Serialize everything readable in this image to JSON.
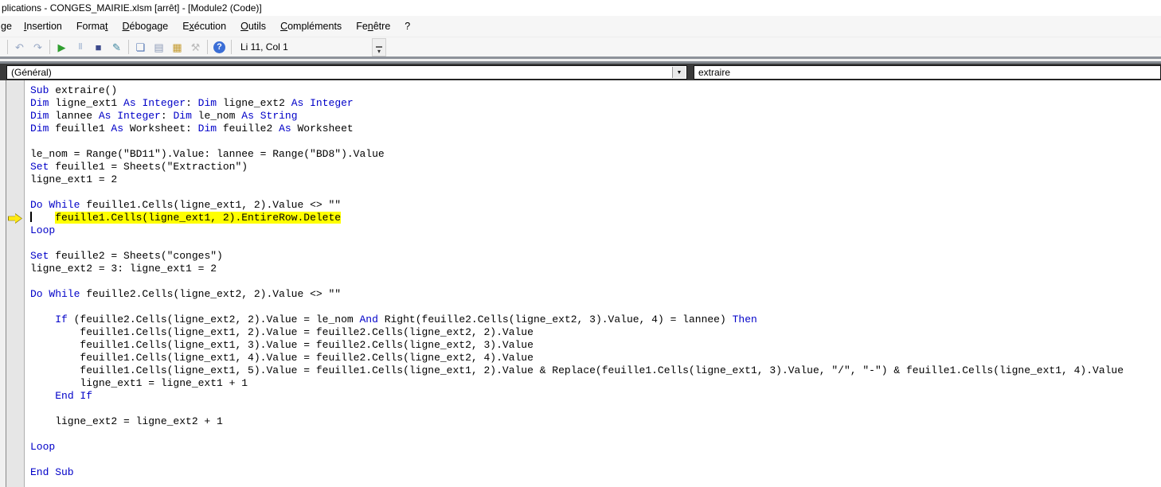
{
  "window": {
    "title": "plications - CONGES_MAIRIE.xlsm [arrêt] - [Module2 (Code)]"
  },
  "menu": {
    "items": [
      {
        "id": "affichage-partial",
        "label": "ge",
        "u": -1
      },
      {
        "id": "insertion",
        "label": "Insertion",
        "u": 0
      },
      {
        "id": "format",
        "label": "Format",
        "u": 5
      },
      {
        "id": "debogage",
        "label": "Débogage",
        "u": 0
      },
      {
        "id": "execution",
        "label": "Exécution",
        "u": 1
      },
      {
        "id": "outils",
        "label": "Outils",
        "u": 0
      },
      {
        "id": "complements",
        "label": "Compléments",
        "u": 0
      },
      {
        "id": "fenetre",
        "label": "Fenêtre",
        "u": 2
      },
      {
        "id": "aide",
        "label": "?",
        "u": -1
      }
    ]
  },
  "toolbar": {
    "position_label": "Li 11, Col 1",
    "items": [
      {
        "type": "sep"
      },
      {
        "type": "icon",
        "name": "undo-icon",
        "glyph": "↶",
        "color": "#97a7c4"
      },
      {
        "type": "icon",
        "name": "redo-icon",
        "glyph": "↷",
        "color": "#97a7c4"
      },
      {
        "type": "sep"
      },
      {
        "type": "icon",
        "name": "run-icon",
        "glyph": "▶",
        "color": "#2f9e2f"
      },
      {
        "type": "icon",
        "name": "pause-icon",
        "glyph": "‖",
        "color": "#a9bbd4",
        "small": true
      },
      {
        "type": "icon",
        "name": "stop-icon",
        "glyph": "■",
        "color": "#3c4a8c"
      },
      {
        "type": "icon",
        "name": "design-mode-icon",
        "glyph": "✎",
        "color": "#3f87a0"
      },
      {
        "type": "sep"
      },
      {
        "type": "icon",
        "name": "project-explorer-icon",
        "glyph": "❏",
        "color": "#4a6fb0"
      },
      {
        "type": "icon",
        "name": "properties-window-icon",
        "glyph": "▤",
        "color": "#8d9cb8"
      },
      {
        "type": "icon",
        "name": "object-browser-icon",
        "glyph": "▦",
        "color": "#c49a2e"
      },
      {
        "type": "icon",
        "name": "toolbox-icon",
        "glyph": "⚒",
        "color": "#bcbcbc"
      },
      {
        "type": "sep"
      },
      {
        "type": "icon",
        "name": "help-icon",
        "glyph": "?",
        "color": "#ffffff",
        "circle": "#3b6ed6"
      },
      {
        "type": "sep"
      }
    ],
    "overflow_chevron": "▾"
  },
  "combos": {
    "object_value": "(Général)",
    "procedure_value": "extraire",
    "chevron": "▼"
  },
  "code": {
    "keyword_color": "#0000C8",
    "highlight_color": "#FFFF00",
    "lines": [
      {
        "segs": [
          [
            "k",
            "Sub"
          ],
          [
            "n",
            " extraire()"
          ]
        ]
      },
      {
        "segs": [
          [
            "k",
            "Dim"
          ],
          [
            "n",
            " ligne_ext1 "
          ],
          [
            "k",
            "As"
          ],
          [
            "n",
            " "
          ],
          [
            "k",
            "Integer"
          ],
          [
            "n",
            ": "
          ],
          [
            "k",
            "Dim"
          ],
          [
            "n",
            " ligne_ext2 "
          ],
          [
            "k",
            "As"
          ],
          [
            "n",
            " "
          ],
          [
            "k",
            "Integer"
          ]
        ]
      },
      {
        "segs": [
          [
            "k",
            "Dim"
          ],
          [
            "n",
            " lannee "
          ],
          [
            "k",
            "As"
          ],
          [
            "n",
            " "
          ],
          [
            "k",
            "Integer"
          ],
          [
            "n",
            ": "
          ],
          [
            "k",
            "Dim"
          ],
          [
            "n",
            " le_nom "
          ],
          [
            "k",
            "As"
          ],
          [
            "n",
            " "
          ],
          [
            "k",
            "String"
          ]
        ]
      },
      {
        "segs": [
          [
            "k",
            "Dim"
          ],
          [
            "n",
            " feuille1 "
          ],
          [
            "k",
            "As"
          ],
          [
            "n",
            " Worksheet: "
          ],
          [
            "k",
            "Dim"
          ],
          [
            "n",
            " feuille2 "
          ],
          [
            "k",
            "As"
          ],
          [
            "n",
            " Worksheet"
          ]
        ]
      },
      {
        "segs": []
      },
      {
        "segs": [
          [
            "n",
            "le_nom = Range(\"BD11\").Value: lannee = Range(\"BD8\").Value"
          ]
        ]
      },
      {
        "segs": [
          [
            "k",
            "Set"
          ],
          [
            "n",
            " feuille1 = Sheets(\"Extraction\")"
          ]
        ]
      },
      {
        "segs": [
          [
            "n",
            "ligne_ext1 = 2"
          ]
        ]
      },
      {
        "segs": []
      },
      {
        "segs": [
          [
            "k",
            "Do While"
          ],
          [
            "n",
            " feuille1.Cells(ligne_ext1, 2).Value <> \"\""
          ]
        ]
      },
      {
        "caret": true,
        "arrow": true,
        "hl": true,
        "indent": "    ",
        "segs": [
          [
            "n",
            "feuille1.Cells(ligne_ext1, 2).EntireRow.Delete"
          ]
        ]
      },
      {
        "segs": [
          [
            "k",
            "Loop"
          ]
        ]
      },
      {
        "segs": []
      },
      {
        "segs": [
          [
            "k",
            "Set"
          ],
          [
            "n",
            " feuille2 = Sheets(\"conges\")"
          ]
        ]
      },
      {
        "segs": [
          [
            "n",
            "ligne_ext2 = 3: ligne_ext1 = 2"
          ]
        ]
      },
      {
        "segs": []
      },
      {
        "segs": [
          [
            "k",
            "Do While"
          ],
          [
            "n",
            " feuille2.Cells(ligne_ext2, 2).Value <> \"\""
          ]
        ]
      },
      {
        "segs": []
      },
      {
        "segs": [
          [
            "n",
            "    "
          ],
          [
            "k",
            "If"
          ],
          [
            "n",
            " (feuille2.Cells(ligne_ext2, 2).Value = le_nom "
          ],
          [
            "k",
            "And"
          ],
          [
            "n",
            " Right(feuille2.Cells(ligne_ext2, 3).Value, 4) = lannee) "
          ],
          [
            "k",
            "Then"
          ]
        ]
      },
      {
        "segs": [
          [
            "n",
            "        feuille1.Cells(ligne_ext1, 2).Value = feuille2.Cells(ligne_ext2, 2).Value"
          ]
        ]
      },
      {
        "segs": [
          [
            "n",
            "        feuille1.Cells(ligne_ext1, 3).Value = feuille2.Cells(ligne_ext2, 3).Value"
          ]
        ]
      },
      {
        "segs": [
          [
            "n",
            "        feuille1.Cells(ligne_ext1, 4).Value = feuille2.Cells(ligne_ext2, 4).Value"
          ]
        ]
      },
      {
        "segs": [
          [
            "n",
            "        feuille1.Cells(ligne_ext1, 5).Value = feuille1.Cells(ligne_ext1, 2).Value & Replace(feuille1.Cells(ligne_ext1, 3).Value, \"/\", \"-\") & feuille1.Cells(ligne_ext1, 4).Value"
          ]
        ]
      },
      {
        "segs": [
          [
            "n",
            "        ligne_ext1 = ligne_ext1 + 1"
          ]
        ]
      },
      {
        "segs": [
          [
            "n",
            "    "
          ],
          [
            "k",
            "End If"
          ]
        ]
      },
      {
        "segs": []
      },
      {
        "segs": [
          [
            "n",
            "    ligne_ext2 = ligne_ext2 + 1"
          ]
        ]
      },
      {
        "segs": []
      },
      {
        "segs": [
          [
            "k",
            "Loop"
          ]
        ]
      },
      {
        "segs": []
      },
      {
        "segs": [
          [
            "k",
            "End Sub"
          ]
        ]
      }
    ]
  }
}
